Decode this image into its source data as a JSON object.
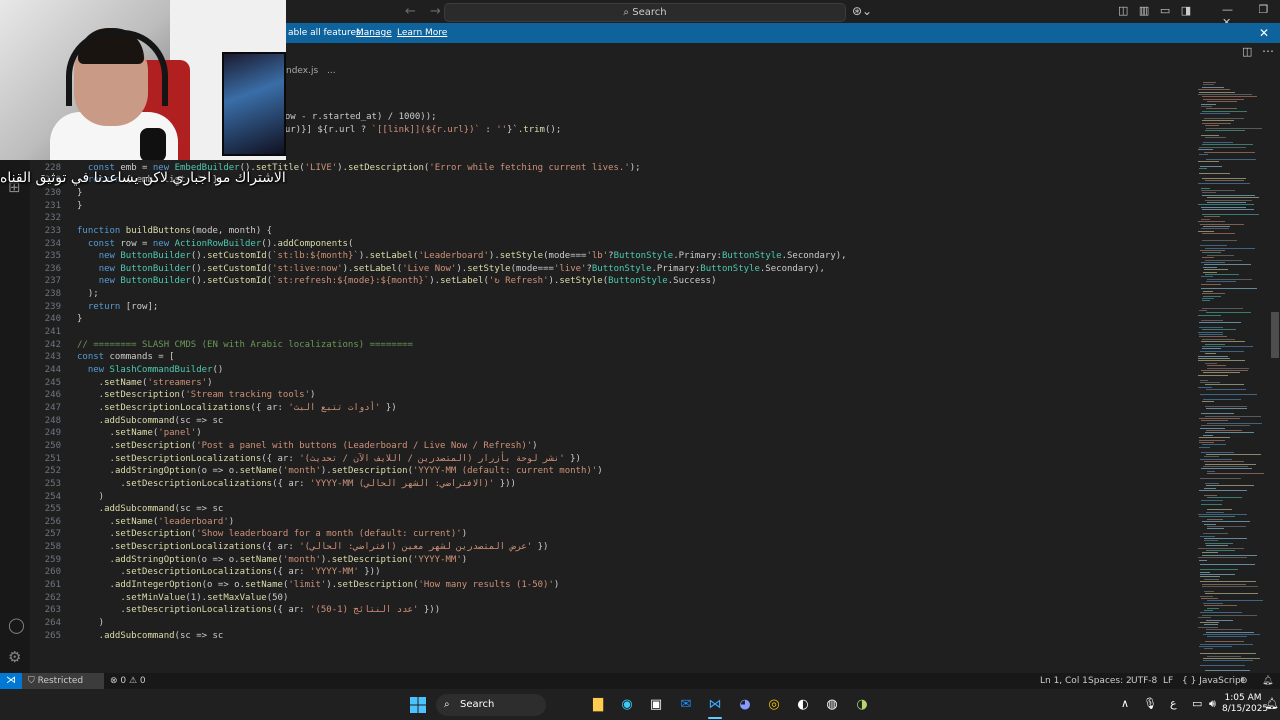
{
  "titlebar": {
    "search_label": "Search",
    "nav_back": "←",
    "nav_forward": "→",
    "search_icon": "⌕",
    "copilot_icon": "⊛⌄"
  },
  "banner": {
    "message_visible": "able all features.",
    "manage": "Manage",
    "learn_more": "Learn More",
    "close": "✕"
  },
  "breadcrumb": {
    "file": "ndex.js",
    "more": "..."
  },
  "caption": {
    "text": "الاشتراك مو اجباري لاكن يساعدنا في توثيق القناه"
  },
  "code": {
    "lines": [
      {
        "n": "",
        "t": "(now - r.started_at) / 1000));",
        "indent": 244
      },
      {
        "n": "",
        "t": "(dur)}] ${r.url ? `[[link]](${r.url})` : ''}`.trim();",
        "indent": 244
      },
      {
        "n": "226",
        "t": "} catch (e) {"
      },
      {
        "n": "227",
        "t": "  console.error(e);"
      },
      {
        "n": "228",
        "t": "  const emb = new EmbedBuilder().setTitle('LIVE').setDescription('Error while fetching current lives.');"
      },
      {
        "n": "229",
        "t": "  return { emb, list: '' };"
      },
      {
        "n": "230",
        "t": "}"
      },
      {
        "n": "231",
        "t": "}"
      },
      {
        "n": "232",
        "t": ""
      },
      {
        "n": "233",
        "t": "function buildButtons(mode, month) {"
      },
      {
        "n": "234",
        "t": "  const row = new ActionRowBuilder().addComponents("
      },
      {
        "n": "235",
        "t": "    new ButtonBuilder().setCustomId(`st:lb:${month}`).setLabel('Leaderboard').setStyle(mode==='lb'?ButtonStyle.Primary:ButtonStyle.Secondary),"
      },
      {
        "n": "236",
        "t": "    new ButtonBuilder().setCustomId('st:live:now').setLabel('Live Now').setStyle(mode==='live'?ButtonStyle.Primary:ButtonStyle.Secondary),"
      },
      {
        "n": "237",
        "t": "    new ButtonBuilder().setCustomId(`st:refresh:${mode}:${month}`).setLabel('↻ Refresh').setStyle(ButtonStyle.Success)"
      },
      {
        "n": "238",
        "t": "  );"
      },
      {
        "n": "239",
        "t": "  return [row];"
      },
      {
        "n": "240",
        "t": "}"
      },
      {
        "n": "241",
        "t": ""
      },
      {
        "n": "242",
        "t": "// ======== SLASH CMDS (EN with Arabic localizations) ========"
      },
      {
        "n": "243",
        "t": "const commands = ["
      },
      {
        "n": "244",
        "t": "  new SlashCommandBuilder()"
      },
      {
        "n": "245",
        "t": "    .setName('streamers')"
      },
      {
        "n": "246",
        "t": "    .setDescription('Stream tracking tools')"
      },
      {
        "n": "247",
        "t": "    .setDescriptionLocalizations({ ar: 'أدوات تتبع البث' })"
      },
      {
        "n": "248",
        "t": "    .addSubcommand(sc => sc"
      },
      {
        "n": "249",
        "t": "      .setName('panel')"
      },
      {
        "n": "250",
        "t": "      .setDescription('Post a panel with buttons (Leaderboard / Live Now / Refresh)')"
      },
      {
        "n": "251",
        "t": "      .setDescriptionLocalizations({ ar: 'نشر لوحة بأزرار (المتصدرين / اللايف الآن / تحديث)' })"
      },
      {
        "n": "252",
        "t": "      .addStringOption(o => o.setName('month').setDescription('YYYY-MM (default: current month)')"
      },
      {
        "n": "253",
        "t": "        .setDescriptionLocalizations({ ar: 'YYYY-MM (الافتراضي: الشهر الحالي)' }))"
      },
      {
        "n": "254",
        "t": "    )"
      },
      {
        "n": "255",
        "t": "    .addSubcommand(sc => sc"
      },
      {
        "n": "256",
        "t": "      .setName('leaderboard')"
      },
      {
        "n": "257",
        "t": "      .setDescription('Show leaderboard for a month (default: current)')"
      },
      {
        "n": "258",
        "t": "      .setDescriptionLocalizations({ ar: 'عرض المتصدرين لشهر معين (افتراضي: الحالي)' })"
      },
      {
        "n": "259",
        "t": "      .addStringOption(o => o.setName('month').setDescription('YYYY-MM')"
      },
      {
        "n": "260",
        "t": "        .setDescriptionLocalizations({ ar: 'YYYY-MM' }))"
      },
      {
        "n": "261",
        "t": "      .addIntegerOption(o => o.setName('limit').setDescription('How many results (1-50)')"
      },
      {
        "n": "262",
        "t": "        .setMinValue(1).setMaxValue(50)"
      },
      {
        "n": "263",
        "t": "        .setDescriptionLocalizations({ ar: 'عدد النتائج (1-50)' }))"
      },
      {
        "n": "264",
        "t": "    )"
      },
      {
        "n": "265",
        "t": "    .addSubcommand(sc => sc"
      }
    ]
  },
  "statusbar": {
    "remote_icon": "⋊",
    "restricted": "⛉ Restricted Mode",
    "problems": "⊗ 0 ⚠ 0",
    "position": "Ln 1, Col 1",
    "spaces": "Spaces: 2",
    "encoding": "UTF-8",
    "eol": "LF",
    "language": "{ } JavaScript"
  },
  "taskbar": {
    "search_label": "Search",
    "time": "1:05 AM",
    "date": "8/15/2025",
    "tray_chevron": "∧",
    "tray_lang": "ع"
  },
  "colors": {
    "editor_bg": "#1f1f1f",
    "banner_bg": "#0e639c",
    "keyword": "#569cd6",
    "string": "#ce9178",
    "function": "#dcdcaa",
    "class": "#4ec9b0",
    "variable": "#9cdcfe",
    "comment": "#6a9955"
  }
}
